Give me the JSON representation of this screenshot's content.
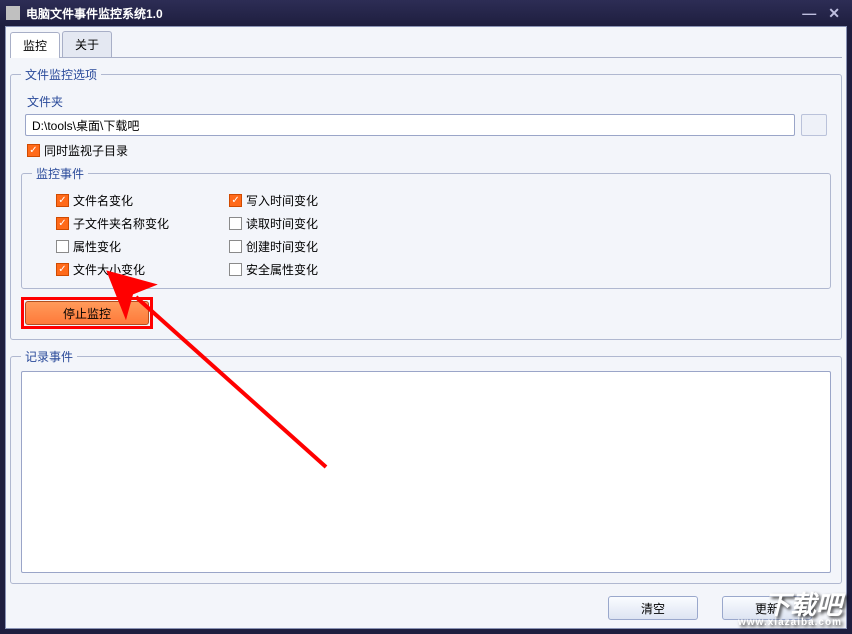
{
  "titlebar": {
    "title": "电脑文件事件监控系统1.0"
  },
  "tabs": {
    "monitor": "监控",
    "about": "关于",
    "active": "monitor"
  },
  "options": {
    "legend": "文件监控选项",
    "folder_label": "文件夹",
    "folder_path": "D:\\tools\\桌面\\下载吧",
    "watch_subdirs_label": "同时监视子目录",
    "watch_subdirs_checked": true,
    "events_legend": "监控事件",
    "events_left": [
      {
        "label": "文件名变化",
        "checked": true
      },
      {
        "label": "子文件夹名称变化",
        "checked": true
      },
      {
        "label": "属性变化",
        "checked": false
      },
      {
        "label": "文件大小变化",
        "checked": true
      }
    ],
    "events_right": [
      {
        "label": "写入时间变化",
        "checked": true
      },
      {
        "label": "读取时间变化",
        "checked": false
      },
      {
        "label": "创建时间变化",
        "checked": false
      },
      {
        "label": "安全属性变化",
        "checked": false
      }
    ],
    "stop_label": "停止监控"
  },
  "log": {
    "legend": "记录事件"
  },
  "buttons": {
    "clear": "清空",
    "refresh": "更新"
  },
  "watermark": {
    "main": "下载吧",
    "sub": "www.xiazaiba.com"
  }
}
